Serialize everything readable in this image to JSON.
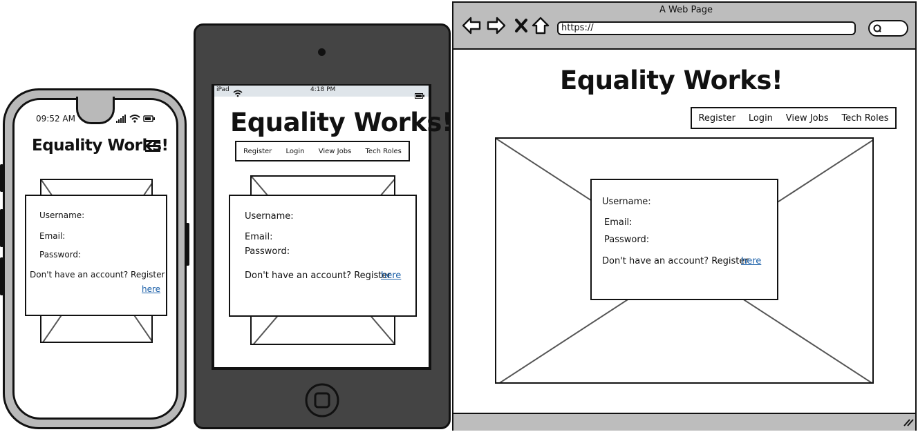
{
  "site_title": "Equality Works!",
  "nav": [
    "Register",
    "Login",
    "View Jobs",
    "Tech Roles"
  ],
  "form": {
    "username_label": "Username:",
    "email_label": "Email:",
    "password_label": "Password:",
    "register_prompt": "Don't have an account? Register",
    "register_link": "here"
  },
  "phone": {
    "time": "09:52 AM",
    "menu_icon": "hamburger-menu-icon"
  },
  "tablet": {
    "device_label": "iPad",
    "time": "4:18 PM"
  },
  "browser": {
    "window_title": "A Web Page",
    "url": "https://"
  },
  "colors": {
    "link": "#1a5fa8",
    "device_frame_phone": "#b9b9b9",
    "device_frame_tablet": "#444444",
    "browser_chrome": "#bdbdbd"
  }
}
